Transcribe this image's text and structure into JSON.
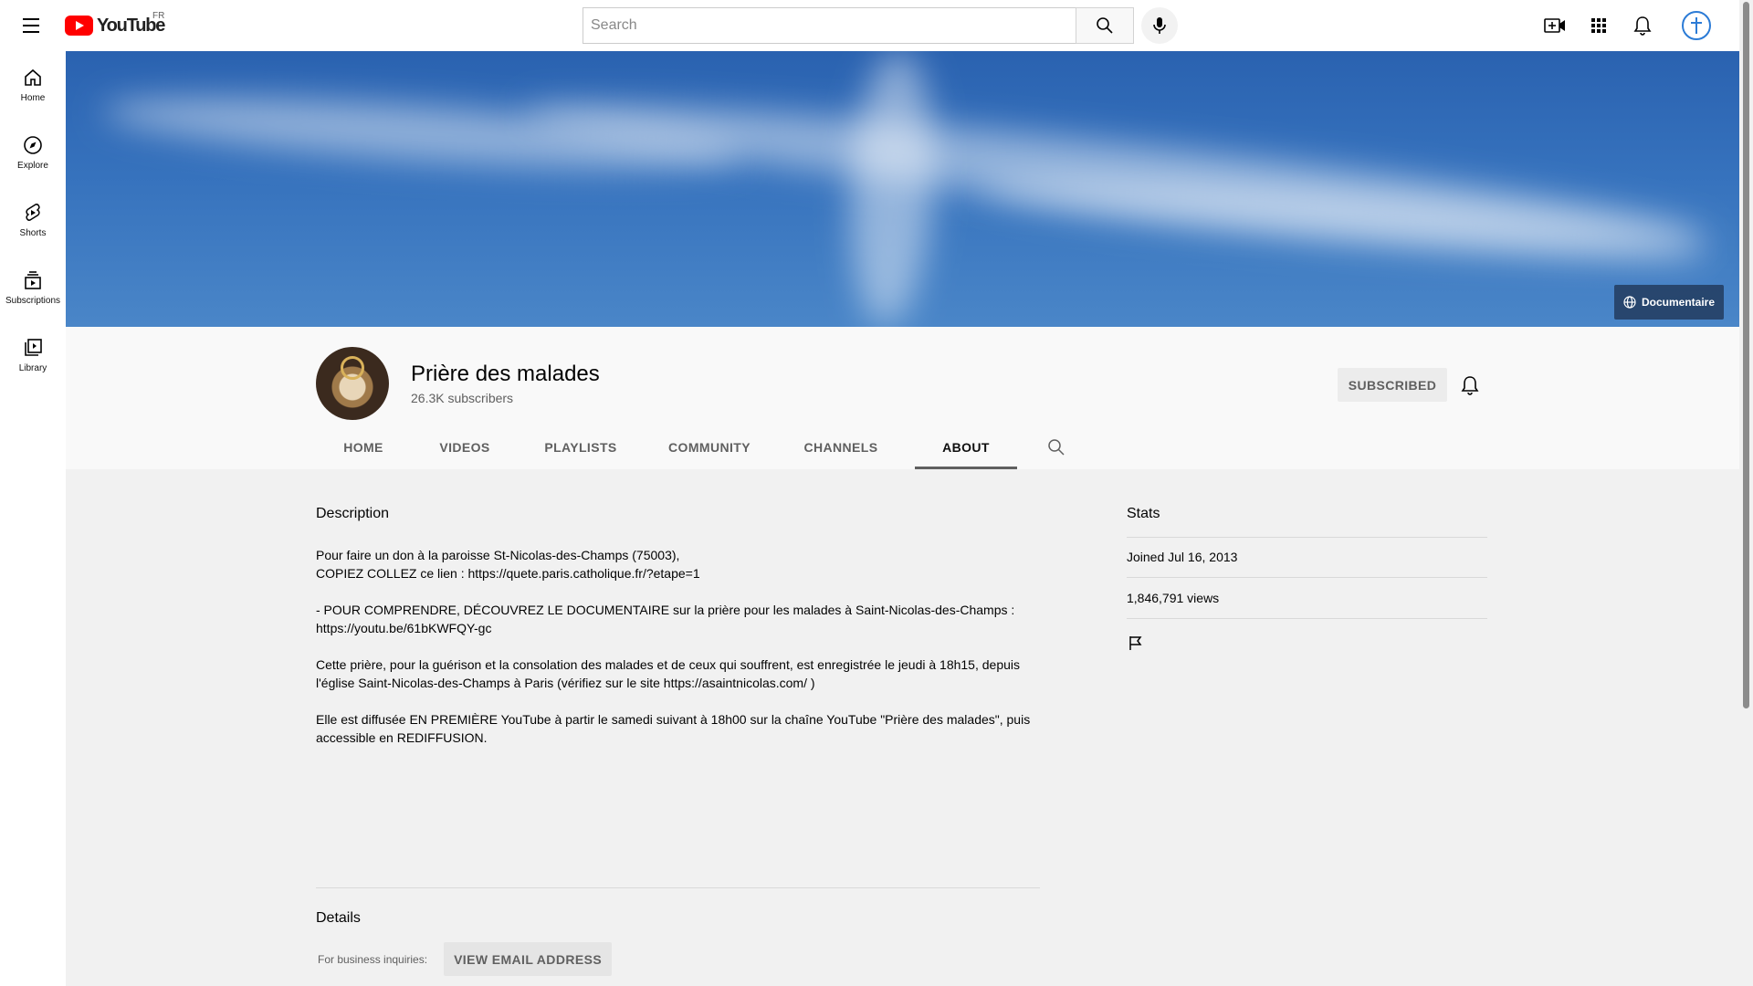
{
  "topbar": {
    "logo_text": "YouTube",
    "country_code": "FR",
    "search_placeholder": "Search"
  },
  "sidebar": {
    "items": [
      {
        "label": "Home",
        "icon": "home-icon"
      },
      {
        "label": "Explore",
        "icon": "compass-icon"
      },
      {
        "label": "Shorts",
        "icon": "shorts-icon"
      },
      {
        "label": "Subscriptions",
        "icon": "subscriptions-icon"
      },
      {
        "label": "Library",
        "icon": "library-icon"
      }
    ]
  },
  "banner": {
    "link_label": "Documentaire"
  },
  "channel": {
    "name": "Prière des malades",
    "subscribers": "26.3K subscribers",
    "subscribe_label": "SUBSCRIBED"
  },
  "tabs": [
    {
      "label": "HOME",
      "active": false
    },
    {
      "label": "VIDEOS",
      "active": false
    },
    {
      "label": "PLAYLISTS",
      "active": false
    },
    {
      "label": "COMMUNITY",
      "active": false
    },
    {
      "label": "CHANNELS",
      "active": false
    },
    {
      "label": "ABOUT",
      "active": true
    }
  ],
  "about": {
    "description_title": "Description",
    "description_text": "Pour faire un don à la paroisse St-Nicolas-des-Champs (75003),\nCOPIEZ COLLEZ ce lien : https://quete.paris.catholique.fr/?etape=1\n\n- POUR COMPRENDRE, DÉCOUVREZ LE DOCUMENTAIRE sur la prière pour les malades à Saint-Nicolas-des-Champs :\nhttps://youtu.be/61bKWFQY-gc\n\nCette prière, pour la guérison et la consolation des malades et de ceux qui souffrent, est enregistrée le jeudi à 18h15, depuis l'église Saint-Nicolas-des-Champs à Paris (vérifiez sur le site https://asaintnicolas.com/ )\n\nElle est diffusée EN PREMIÈRE YouTube à partir le samedi suivant à 18h00 sur la chaîne YouTube \"Prière des malades\", puis accessible en REDIFFUSION.",
    "details_title": "Details",
    "business_label": "For business inquiries:",
    "email_button": "VIEW EMAIL ADDRESS"
  },
  "stats": {
    "title": "Stats",
    "joined": "Joined Jul 16, 2013",
    "views": "1,846,791 views"
  },
  "colors": {
    "brand_red": "#ff0000",
    "banner_blue": "#3672bd"
  }
}
